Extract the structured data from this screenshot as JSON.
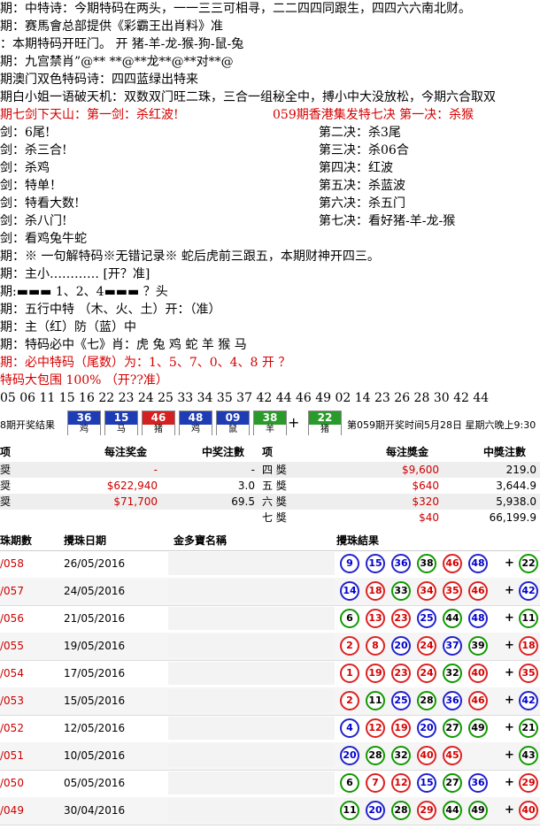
{
  "lines": [
    {
      "text": "期：中特诗：今期特码在两头，一一三三可相寻，二二四四同跟生，四四六六南北财。",
      "color": "#000"
    },
    {
      "text": "期：赛馬會总部提供《彩霸王出肖料》准",
      "color": "#000"
    },
    {
      "text": "：本期特码开旺门。        开 猪-羊-龙-猴-狗-鼠-兔",
      "color": "#000"
    },
    {
      "text": "期：九宫禁肖”@** **@**龙**@**对**@",
      "color": "#000"
    },
    {
      "text": "期澳门双色特码诗：四四蓝绿出特来",
      "color": "#000"
    },
    {
      "text": "期白小姐一语破天机：双数双门旺二珠，三合一组秘全中，搏小中大没放松，今期六合取双",
      "color": "#000"
    }
  ],
  "swords_header": {
    "left": "期七剑下天山：第一剑：杀红波!",
    "right": "059期香港集发特七决 第一决：杀猴"
  },
  "swords": [
    {
      "left": "剑：6尾!",
      "right": "第二决：杀3尾"
    },
    {
      "left": "剑：杀三合!",
      "right": "第三决：杀06合"
    },
    {
      "left": "剑：杀鸡",
      "right": "第四决：红波"
    },
    {
      "left": "剑：特单！",
      "right": "第五决：杀蓝波"
    },
    {
      "left": "剑：特看大数!",
      "right": "第六决：杀五门"
    },
    {
      "left": "剑：杀八门!",
      "right": "第七决：看好猪-羊-龙-猴"
    }
  ],
  "lines2": [
    {
      "text": "剑：看鸡兔牛蛇",
      "color": "#000"
    },
    {
      "text": "期：※ 一句解特码※无错记录※ 蛇后虎前三跟五，本期财神开四三。",
      "color": "#000"
    },
    {
      "text": "期：主小………… [开？准]",
      "color": "#000"
    },
    {
      "text": "期:▬▬▬ 1、2、4▬▬▬ ？头",
      "color": "#000"
    },
    {
      "text": "期：五行中特  （木、火、土）开：（准）",
      "color": "#000"
    },
    {
      "text": "期：主（红）防（蓝）中",
      "color": "#000"
    },
    {
      "text": "期：特码必中《七》肖：虎 兔 鸡 蛇 羊 猴 马",
      "color": "#000"
    },
    {
      "text": "期：必中特码（尾数）为：1、5、7、0、4、8     开 ？",
      "color": "#d40000"
    },
    {
      "text": "特码大包围 100%   （开??准）",
      "color": "#d40000"
    },
    {
      "text": "05 06 11 15 16 22 23 24 25 33 34 35 37 42 44 46 49 02 14 23 26 28 30 42 44",
      "color": "#000"
    }
  ],
  "ribbon": {
    "label": "8期开奖结果",
    "balls": [
      {
        "num": "36",
        "zod": "鸡",
        "color": "#1e3cb4"
      },
      {
        "num": "15",
        "zod": "马",
        "color": "#1e3cb4"
      },
      {
        "num": "46",
        "zod": "猪",
        "color": "#d42020"
      },
      {
        "num": "48",
        "zod": "鸡",
        "color": "#1e3cb4"
      },
      {
        "num": "09",
        "zod": "鼠",
        "color": "#1e3cb4"
      },
      {
        "num": "38",
        "zod": "羊",
        "color": "#2a9a2a"
      }
    ],
    "special": {
      "num": "22",
      "zod": "猪",
      "color": "#2a9a2a"
    },
    "plus": "+",
    "info": "第059期开奖时间5月28日 星期六晚上9:30"
  },
  "prizes": {
    "headers": [
      "项",
      "每注奖金",
      "中奖注數",
      "项",
      "每注獎金",
      "中獎注數"
    ],
    "rows": [
      {
        "a": "奨",
        "b": "-",
        "c": "-",
        "d": "四 獎",
        "e": "$9,600",
        "f": "219.0"
      },
      {
        "a": "奨",
        "b": "$622,940",
        "c": "3.0",
        "d": "五 獎",
        "e": "$640",
        "f": "3,644.9"
      },
      {
        "a": "奨",
        "b": "$71,700",
        "c": "69.5",
        "d": "六 獎",
        "e": "$320",
        "f": "5,938.0"
      },
      {
        "a": "",
        "b": "",
        "c": "",
        "d": "七 獎",
        "e": "$40",
        "f": "66,199.9"
      }
    ]
  },
  "history": {
    "headers": [
      "珠期數",
      "攪珠日期",
      "金多寶名稱",
      "攪珠結果"
    ],
    "rows": [
      {
        "id": "/058",
        "date": "26/05/2016",
        "balls": [
          [
            "9",
            "blue"
          ],
          [
            "15",
            "blue"
          ],
          [
            "36",
            "blue"
          ],
          [
            "38",
            "green"
          ],
          [
            "46",
            "red"
          ],
          [
            "48",
            "blue"
          ]
        ],
        "special": [
          "22",
          "green"
        ]
      },
      {
        "id": "/057",
        "date": "24/05/2016",
        "balls": [
          [
            "14",
            "blue"
          ],
          [
            "18",
            "red"
          ],
          [
            "33",
            "green"
          ],
          [
            "34",
            "red"
          ],
          [
            "35",
            "red"
          ],
          [
            "46",
            "red"
          ]
        ],
        "special": [
          "42",
          "blue"
        ]
      },
      {
        "id": "/056",
        "date": "21/05/2016",
        "balls": [
          [
            "6",
            "green"
          ],
          [
            "13",
            "red"
          ],
          [
            "23",
            "red"
          ],
          [
            "25",
            "blue"
          ],
          [
            "44",
            "green"
          ],
          [
            "48",
            "blue"
          ]
        ],
        "special": [
          "11",
          "green"
        ]
      },
      {
        "id": "/055",
        "date": "19/05/2016",
        "balls": [
          [
            "2",
            "red"
          ],
          [
            "8",
            "red"
          ],
          [
            "20",
            "blue"
          ],
          [
            "24",
            "red"
          ],
          [
            "37",
            "blue"
          ],
          [
            "39",
            "green"
          ]
        ],
        "special": [
          "18",
          "red"
        ]
      },
      {
        "id": "/054",
        "date": "17/05/2016",
        "balls": [
          [
            "1",
            "red"
          ],
          [
            "19",
            "red"
          ],
          [
            "23",
            "red"
          ],
          [
            "24",
            "red"
          ],
          [
            "32",
            "green"
          ],
          [
            "40",
            "red"
          ]
        ],
        "special": [
          "35",
          "red"
        ]
      },
      {
        "id": "/053",
        "date": "15/05/2016",
        "balls": [
          [
            "2",
            "red"
          ],
          [
            "11",
            "green"
          ],
          [
            "25",
            "blue"
          ],
          [
            "28",
            "green"
          ],
          [
            "36",
            "blue"
          ],
          [
            "46",
            "red"
          ]
        ],
        "special": [
          "42",
          "blue"
        ]
      },
      {
        "id": "/052",
        "date": "12/05/2016",
        "balls": [
          [
            "4",
            "blue"
          ],
          [
            "12",
            "red"
          ],
          [
            "19",
            "red"
          ],
          [
            "20",
            "blue"
          ],
          [
            "27",
            "green"
          ],
          [
            "49",
            "green"
          ]
        ],
        "special": [
          "21",
          "green"
        ]
      },
      {
        "id": "/051",
        "date": "10/05/2016",
        "balls": [
          [
            "20",
            "blue"
          ],
          [
            "28",
            "green"
          ],
          [
            "32",
            "green"
          ],
          [
            "40",
            "red"
          ],
          [
            "45",
            "red"
          ]
        ],
        "special": [
          "43",
          "green"
        ]
      },
      {
        "id": "/050",
        "date": "05/05/2016",
        "balls": [
          [
            "6",
            "green"
          ],
          [
            "7",
            "red"
          ],
          [
            "12",
            "red"
          ],
          [
            "15",
            "blue"
          ],
          [
            "27",
            "green"
          ],
          [
            "36",
            "blue"
          ]
        ],
        "special": [
          "29",
          "red"
        ]
      },
      {
        "id": "/049",
        "date": "30/04/2016",
        "balls": [
          [
            "11",
            "green"
          ],
          [
            "20",
            "blue"
          ],
          [
            "28",
            "green"
          ],
          [
            "29",
            "red"
          ],
          [
            "44",
            "green"
          ],
          [
            "49",
            "green"
          ]
        ],
        "special": [
          "40",
          "red"
        ]
      }
    ]
  }
}
